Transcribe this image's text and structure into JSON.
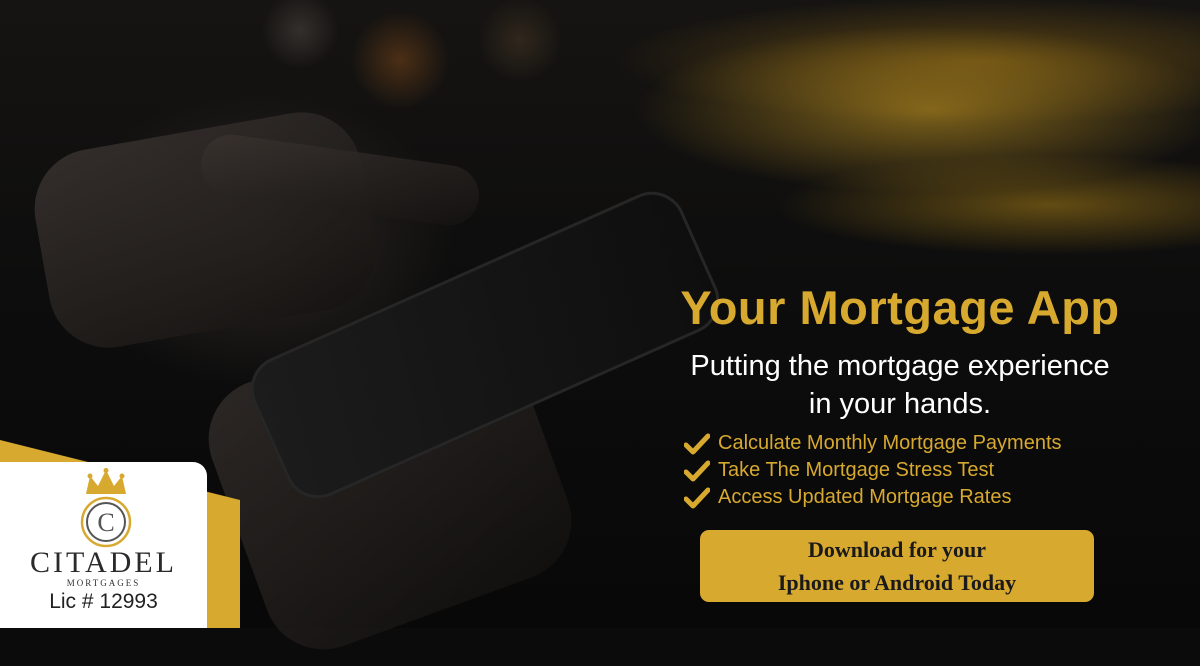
{
  "brand": {
    "name": "CITADEL",
    "sub": "MORTGAGES",
    "license": "Lic # 12993",
    "logo_letter": "C"
  },
  "headline": "Your Mortgage App",
  "subheadline": {
    "line1": "Putting the mortgage experience",
    "line2": "in your hands."
  },
  "features": [
    "Calculate Monthly Mortgage Payments",
    "Take The Mortgage Stress Test",
    "Access Updated Mortgage Rates"
  ],
  "cta": {
    "line1": "Download for your",
    "line2": "Iphone or Android Today"
  },
  "colors": {
    "gold": "#d8a92f",
    "white": "#ffffff",
    "background": "#0b0b0b"
  },
  "icons": [
    "check-icon",
    "crown-icon"
  ]
}
